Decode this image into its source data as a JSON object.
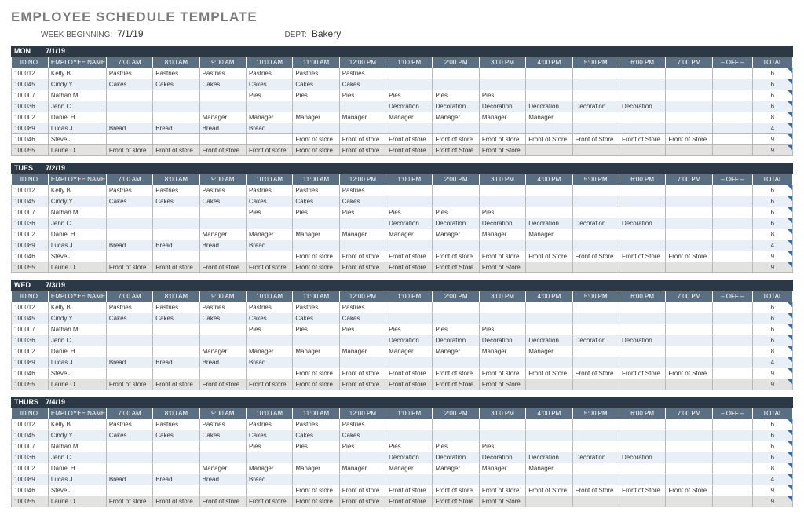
{
  "title": "EMPLOYEE SCHEDULE TEMPLATE",
  "header": {
    "week_label": "WEEK BEGINNING:",
    "week_value": "7/1/19",
    "dept_label": "DEPT:",
    "dept_value": "Bakery"
  },
  "columns": {
    "id": "ID NO.",
    "name": "EMPLOYEE NAME",
    "hours": [
      "7:00 AM",
      "8:00 AM",
      "9:00 AM",
      "10:00 AM",
      "11:00 AM",
      "12:00 PM",
      "1:00 PM",
      "2:00 PM",
      "3:00 PM",
      "4:00 PM",
      "5:00 PM",
      "6:00 PM",
      "7:00 PM"
    ],
    "off": "– OFF –",
    "total": "TOTAL"
  },
  "days": [
    {
      "label": "MON",
      "date": "7/1/19"
    },
    {
      "label": "TUES",
      "date": "7/2/19"
    },
    {
      "label": "WED",
      "date": "7/3/19"
    },
    {
      "label": "THURS",
      "date": "7/4/19"
    }
  ],
  "rows": [
    {
      "style": "plain",
      "id": "100012",
      "name": "Kelly B.",
      "cells": [
        "Pastries",
        "Pastries",
        "Pastries",
        "Pastries",
        "Pastries",
        "Pastries",
        "",
        "",
        "",
        "",
        "",
        "",
        ""
      ],
      "total": "6"
    },
    {
      "style": "shade",
      "id": "100045",
      "name": "Cindy Y.",
      "cells": [
        "Cakes",
        "Cakes",
        "Cakes",
        "Cakes",
        "Cakes",
        "Cakes",
        "",
        "",
        "",
        "",
        "",
        "",
        ""
      ],
      "total": "6"
    },
    {
      "style": "plain",
      "id": "100007",
      "name": "Nathan M.",
      "cells": [
        "",
        "",
        "",
        "Pies",
        "Pies",
        "Pies",
        "Pies",
        "Pies",
        "Pies",
        "",
        "",
        "",
        ""
      ],
      "total": "6"
    },
    {
      "style": "shade",
      "id": "100036",
      "name": "Jenn C.",
      "cells": [
        "",
        "",
        "",
        "",
        "",
        "",
        "Decoration",
        "Decoration",
        "Decoration",
        "Decoration",
        "Decoration",
        "Decoration",
        ""
      ],
      "total": "6"
    },
    {
      "style": "plain",
      "id": "100002",
      "name": "Daniel H.",
      "cells": [
        "",
        "",
        "Manager",
        "Manager",
        "Manager",
        "Manager",
        "Manager",
        "Manager",
        "Manager",
        "Manager",
        "",
        "",
        ""
      ],
      "total": "8"
    },
    {
      "style": "shade",
      "id": "100089",
      "name": "Lucas J.",
      "cells": [
        "Bread",
        "Bread",
        "Bread",
        "Bread",
        "",
        "",
        "",
        "",
        "",
        "",
        "",
        "",
        ""
      ],
      "total": "4"
    },
    {
      "style": "plain",
      "id": "100046",
      "name": "Steve J.",
      "cells": [
        "",
        "",
        "",
        "",
        "Front of store",
        "Front of store",
        "Front of store",
        "Front of store",
        "Front of store",
        "Front of Store",
        "Front of Store",
        "Front of Store",
        "Front of Store"
      ],
      "total": "9"
    },
    {
      "style": "gray",
      "id": "100055",
      "name": "Laurie O.",
      "cells": [
        "Front of store",
        "Front of store",
        "Front of store",
        "Front of store",
        "Front of store",
        "Front of store",
        "Front of store",
        "Front of Store",
        "Front of Store",
        "",
        "",
        "",
        ""
      ],
      "total": "9"
    }
  ]
}
